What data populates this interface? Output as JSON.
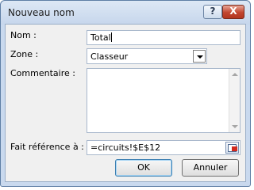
{
  "window": {
    "title": "Nouveau nom",
    "help_glyph": "?",
    "close_glyph": "X"
  },
  "form": {
    "name_label": "Nom :",
    "name_value": "Total",
    "zone_label": "Zone :",
    "zone_value": "Classeur",
    "comment_label": "Commentaire :",
    "comment_value": "",
    "refers_label": "Fait référence à :",
    "refers_value": "=circuits!$E$12"
  },
  "buttons": {
    "ok_label": "OK",
    "cancel_label": "Annuler"
  },
  "icons": {
    "help": "question-icon",
    "close": "close-icon",
    "dropdown": "chevron-down-icon",
    "collapse_dialog": "collapse-dialog-icon"
  },
  "colors": {
    "title_bar": "#c6d6ec",
    "close_button": "#c2452f",
    "dialog_bg": "#f0f0f0",
    "accent": "#3c7fb1"
  }
}
